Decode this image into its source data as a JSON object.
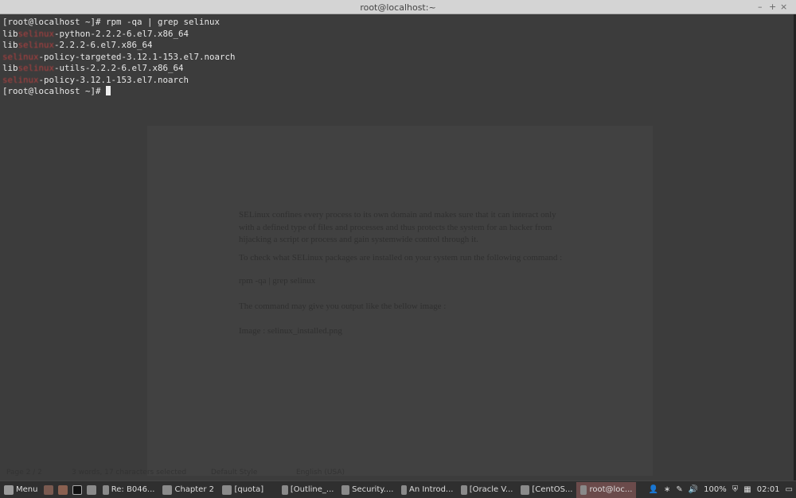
{
  "window": {
    "title": "root@localhost:~",
    "minimize": "–",
    "maximize": "+",
    "close": "×"
  },
  "terminal": {
    "lines": [
      {
        "pre": "[root@localhost ~]# rpm -qa | grep selinux",
        "red": "",
        "post": ""
      },
      {
        "pre": "lib",
        "red": "selinux",
        "post": "-python-2.2.2-6.el7.x86_64"
      },
      {
        "pre": "lib",
        "red": "selinux",
        "post": "-2.2.2-6.el7.x86_64"
      },
      {
        "pre": "",
        "red": "selinux",
        "post": "-policy-targeted-3.12.1-153.el7.noarch"
      },
      {
        "pre": "lib",
        "red": "selinux",
        "post": "-utils-2.2.2-6.el7.x86_64"
      },
      {
        "pre": "",
        "red": "selinux",
        "post": "-policy-3.12.1-153.el7.noarch"
      }
    ],
    "prompt": "[root@localhost ~]# "
  },
  "background_document": {
    "paragraphs": [
      "SELinux confines every process to its own domain and makes sure that it can interact only with a defined type of files and processes and thus protects the system for an hacker from hijacking a script or process and gain systemwide control through it.",
      "To check what SELinux packages are installed on your system run the following command :",
      "rpm -qa | grep selinux",
      "The command may give you output like the bellow image :",
      "Image : selinux_installed.png"
    ],
    "status": [
      "Page 2 / 2",
      "3 words, 17 characters selected",
      "Default Style",
      "English (USA)"
    ]
  },
  "taskbar": {
    "menu": "Menu",
    "tasks": [
      "Re: B046...",
      "Chapter 2",
      "[quota]",
      "[Outline_...",
      "Security....",
      "An Introd...",
      "[Oracle V...",
      "[CentOS...",
      "root@loc..."
    ],
    "active_index": 8,
    "battery": "100%",
    "clock": "02:01"
  }
}
